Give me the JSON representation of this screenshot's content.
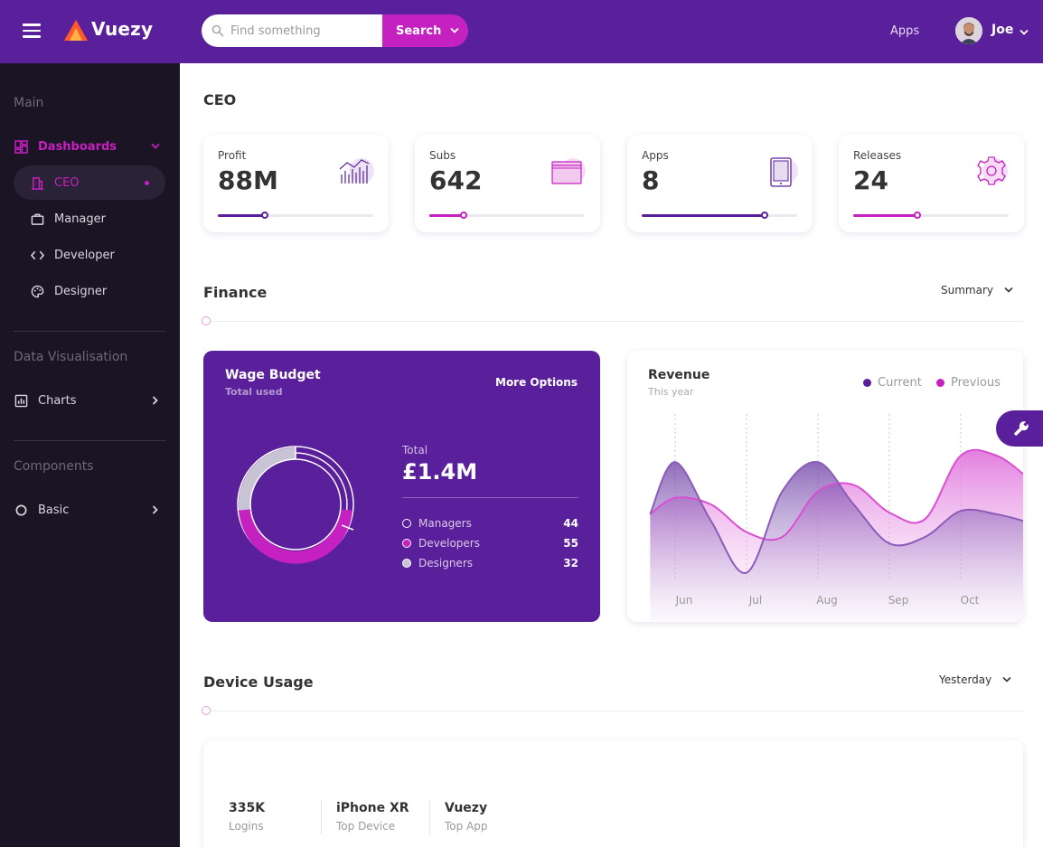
{
  "brand": {
    "name": "Vuezy"
  },
  "search": {
    "placeholder": "Find something",
    "button_label": "Search"
  },
  "header": {
    "apps_label": "Apps",
    "user_name": "Joe"
  },
  "sidebar": {
    "sections": [
      "Main",
      "Data Visualisation",
      "Components"
    ],
    "dashboards_label": "Dashboards",
    "dashboard_items": [
      "CEO",
      "Manager",
      "Developer",
      "Designer"
    ],
    "charts_label": "Charts",
    "basic_label": "Basic"
  },
  "page": {
    "title": "CEO"
  },
  "stats": [
    {
      "label": "Profit",
      "value": "88M",
      "progress": 0.3,
      "color": "#5a1f9a"
    },
    {
      "label": "Subs",
      "value": "642",
      "progress": 0.22,
      "color": "#c520c0"
    },
    {
      "label": "Apps",
      "value": "8",
      "progress": 0.79,
      "color": "#5a1f9a"
    },
    {
      "label": "Releases",
      "value": "24",
      "progress": 0.41,
      "color": "#c520c0"
    }
  ],
  "finance": {
    "title": "Finance",
    "dropdown": "Summary"
  },
  "wage": {
    "title": "Wage Budget",
    "subtitle": "Total used",
    "more": "More Options",
    "total_label": "Total",
    "total_value": "£1.4M",
    "legend": [
      {
        "name": "Managers",
        "value": "44",
        "color": "transparent"
      },
      {
        "name": "Developers",
        "value": "55",
        "color": "#c520c0"
      },
      {
        "name": "Designers",
        "value": "32",
        "color": "#c9c3d6"
      }
    ]
  },
  "revenue": {
    "title": "Revenue",
    "subtitle": "This year",
    "legend": [
      {
        "name": "Current",
        "color": "#5a1f9a"
      },
      {
        "name": "Previous",
        "color": "#c520c0"
      }
    ]
  },
  "chart_data": {
    "type": "area",
    "title": "Revenue",
    "subtitle": "This year",
    "categories": [
      "Jun",
      "Jul",
      "Aug",
      "Sep",
      "Oct"
    ],
    "x": [
      0.65,
      1.0,
      1.5,
      2.0,
      2.5,
      3.0,
      3.5,
      4.0,
      4.5,
      5.0,
      5.5,
      5.95
    ],
    "series": [
      {
        "name": "Current",
        "color": "#8b5bb8",
        "values": [
          44,
          76,
          40,
          8,
          58,
          76,
          50,
          26,
          30,
          46,
          44,
          39
        ]
      },
      {
        "name": "Previous",
        "color": "#d84fd3",
        "values": [
          44,
          54,
          50,
          33,
          30,
          58,
          62,
          45,
          41,
          80,
          80,
          66
        ]
      }
    ],
    "ylim": [
      0,
      100
    ],
    "grid": "vertical-dashed",
    "legend": "top-right"
  },
  "device": {
    "title": "Device Usage",
    "dropdown": "Yesterday",
    "stats": [
      {
        "value": "335K",
        "label": "Logins"
      },
      {
        "value": "iPhone XR",
        "label": "Top Device"
      },
      {
        "value": "Vuezy",
        "label": "Top App"
      }
    ]
  }
}
